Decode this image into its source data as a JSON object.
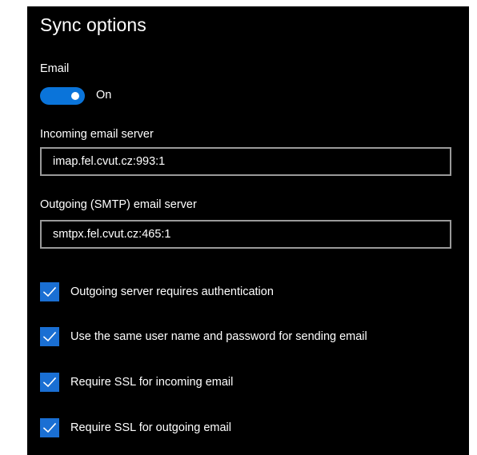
{
  "sync": {
    "title": "Sync options",
    "email_label": "Email",
    "email_toggle_state": "On",
    "incoming_label": "Incoming email server",
    "incoming_value": "imap.fel.cvut.cz:993:1",
    "outgoing_label": "Outgoing (SMTP) email server",
    "outgoing_value": "smtpx.fel.cvut.cz:465:1",
    "checkboxes": [
      {
        "label": "Outgoing server requires authentication",
        "checked": true
      },
      {
        "label": "Use the same user name and password for sending email",
        "checked": true
      },
      {
        "label": "Require SSL for incoming email",
        "checked": true
      },
      {
        "label": "Require SSL for outgoing email",
        "checked": true
      }
    ]
  },
  "colors": {
    "background": "#000000",
    "accent": "#0a74da",
    "checkbox": "#1a6fd3",
    "border": "#9a9a9a",
    "text": "#ffffff"
  },
  "icons": {
    "checkbox_icon": "checkmark-icon"
  }
}
